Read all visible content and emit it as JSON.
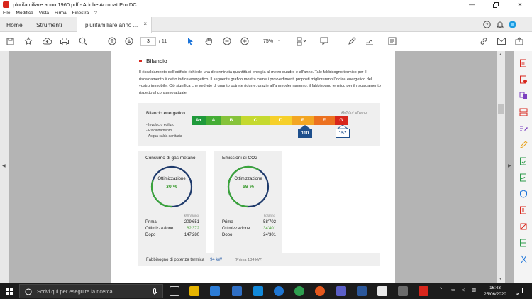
{
  "window": {
    "title": "plurifamiliare anno 1960.pdf - Adobe Acrobat Pro DC"
  },
  "menu": [
    "File",
    "Modifica",
    "Vista",
    "Firma",
    "Finestra",
    "?"
  ],
  "tabs": {
    "home": "Home",
    "tools": "Strumenti",
    "document": "plurifamiliare anno ...",
    "close_glyph": "×"
  },
  "toolbar": {
    "page_current": "3",
    "page_total": "/ 11",
    "zoom": "75%"
  },
  "document": {
    "section_title": "Bilancio",
    "paragraph": "Il riscaldamento dell'edificio richiede una determinata quantità di energia al metro quadro e all'anno. Tale fabbisogno termico per il riscaldamento è detto indice energetico. Il seguente grafico mostra come i provvedimenti proposti migliorerann l'indice energetico del vostro immobile. Ciò significa che vedrete di quanto potrete ridurre, grazie all'ammodernamento, il fabbisogno termico per il riscaldamento rispetto al consumo attuale.",
    "energy": {
      "title": "Bilancio energetico",
      "unit": "kWh/m² all'anno",
      "items": [
        "- Involucro edilizio",
        "- Riscaldamento",
        "- Acqua calda sanitaria"
      ],
      "classes": [
        {
          "label": "A+",
          "color": "#1f9a3b"
        },
        {
          "label": "A",
          "color": "#44ad35"
        },
        {
          "label": "B",
          "color": "#86c33a"
        },
        {
          "label": "C",
          "color": "#c5d92f"
        },
        {
          "label": "D",
          "color": "#f6d02a"
        },
        {
          "label": "E",
          "color": "#f3a623"
        },
        {
          "label": "F",
          "color": "#ec7120"
        },
        {
          "label": "G",
          "color": "#d8261c"
        }
      ],
      "after_value": "110",
      "before_value": "157",
      "after_color": "#1e4f8c",
      "before_color": "#1e4f8c"
    },
    "gas": {
      "title": "Consumo di gas metano",
      "opt_label": "Ottimizzazione",
      "percent": "30 %",
      "percent_value": 30,
      "unit": "kWh/anno",
      "rows": [
        {
          "label": "Prima",
          "value": "209'651"
        },
        {
          "label": "Ottimizzazione",
          "value": "62'372"
        },
        {
          "label": "Dopo",
          "value": "147'280"
        }
      ]
    },
    "co2": {
      "title": "Emissioni di CO2",
      "opt_label": "Ottimizzazione",
      "percent": "59 %",
      "percent_value": 59,
      "unit": "kg/anno",
      "rows": [
        {
          "label": "Prima",
          "value": "58'702"
        },
        {
          "label": "Ottimizzazione",
          "value": "34'401"
        },
        {
          "label": "Dopo",
          "value": "24'301"
        }
      ]
    },
    "fabbisogno": {
      "label": "Fabbisogno di potenza termica",
      "value": "94 kW",
      "prima": "(Prima 134 kW)"
    },
    "colors": {
      "ring_dark": "#1e3a6b",
      "ring_green": "#3aa53a"
    }
  },
  "taskbar": {
    "search_placeholder": "Scrivi qui per eseguire la ricerca",
    "time": "16:43",
    "date": "25/06/2020"
  }
}
